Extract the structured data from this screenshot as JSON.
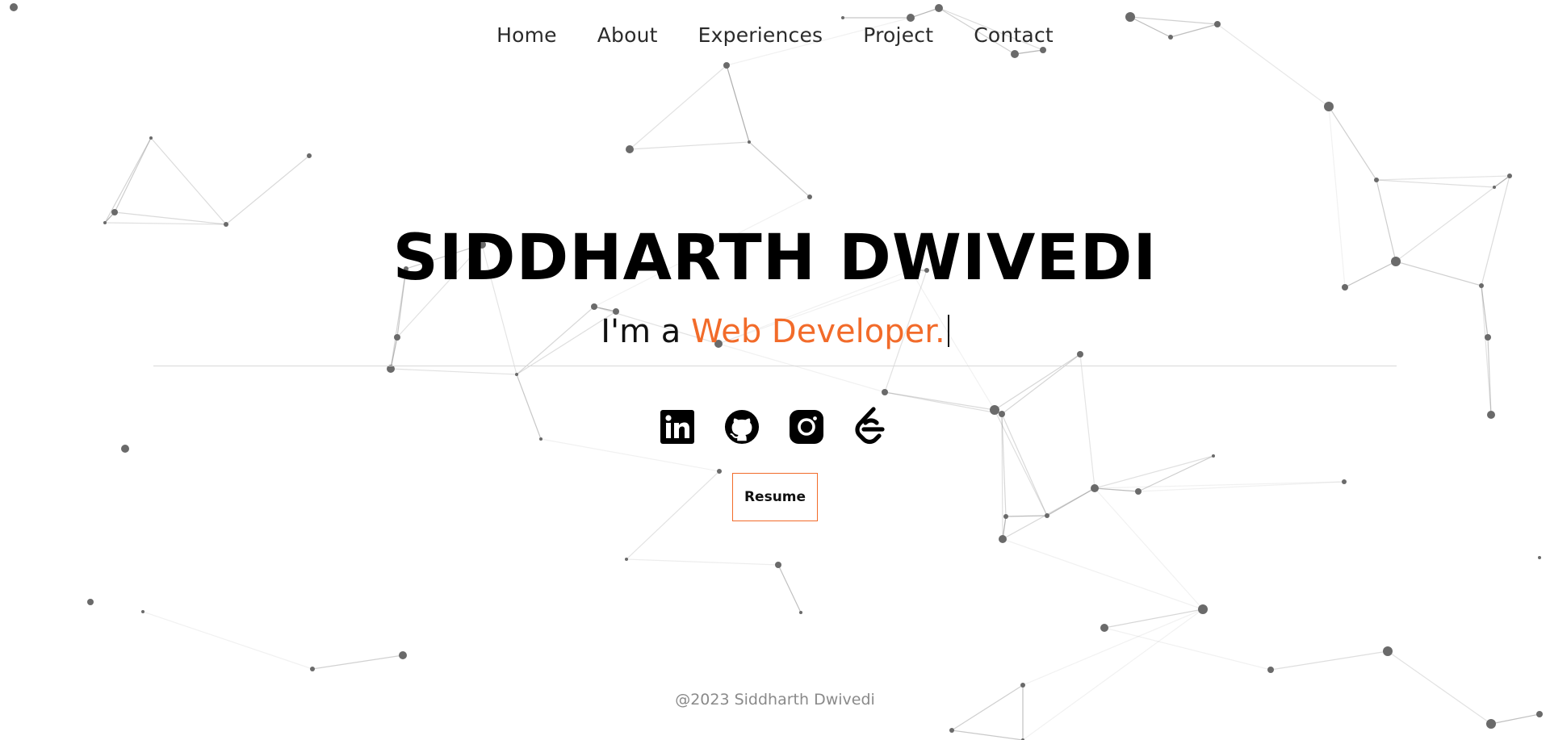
{
  "nav": {
    "items": [
      {
        "label": "Home"
      },
      {
        "label": "About"
      },
      {
        "label": "Experiences"
      },
      {
        "label": "Project"
      },
      {
        "label": "Contact"
      }
    ]
  },
  "hero": {
    "name": "SIDDHARTH DWIVEDI",
    "tagline_prefix": "I'm a",
    "tagline_role": "Web Developer."
  },
  "social": {
    "icons": [
      "linkedin-icon",
      "github-icon",
      "instagram-icon",
      "leetcode-icon"
    ]
  },
  "resume": {
    "label": "Resume"
  },
  "footer": {
    "text": "@2023 Siddharth Dwivedi"
  },
  "colors": {
    "accent": "#f26b2a",
    "text": "#000000",
    "muted": "#8a8a8a",
    "network": "#6a6a6a"
  }
}
